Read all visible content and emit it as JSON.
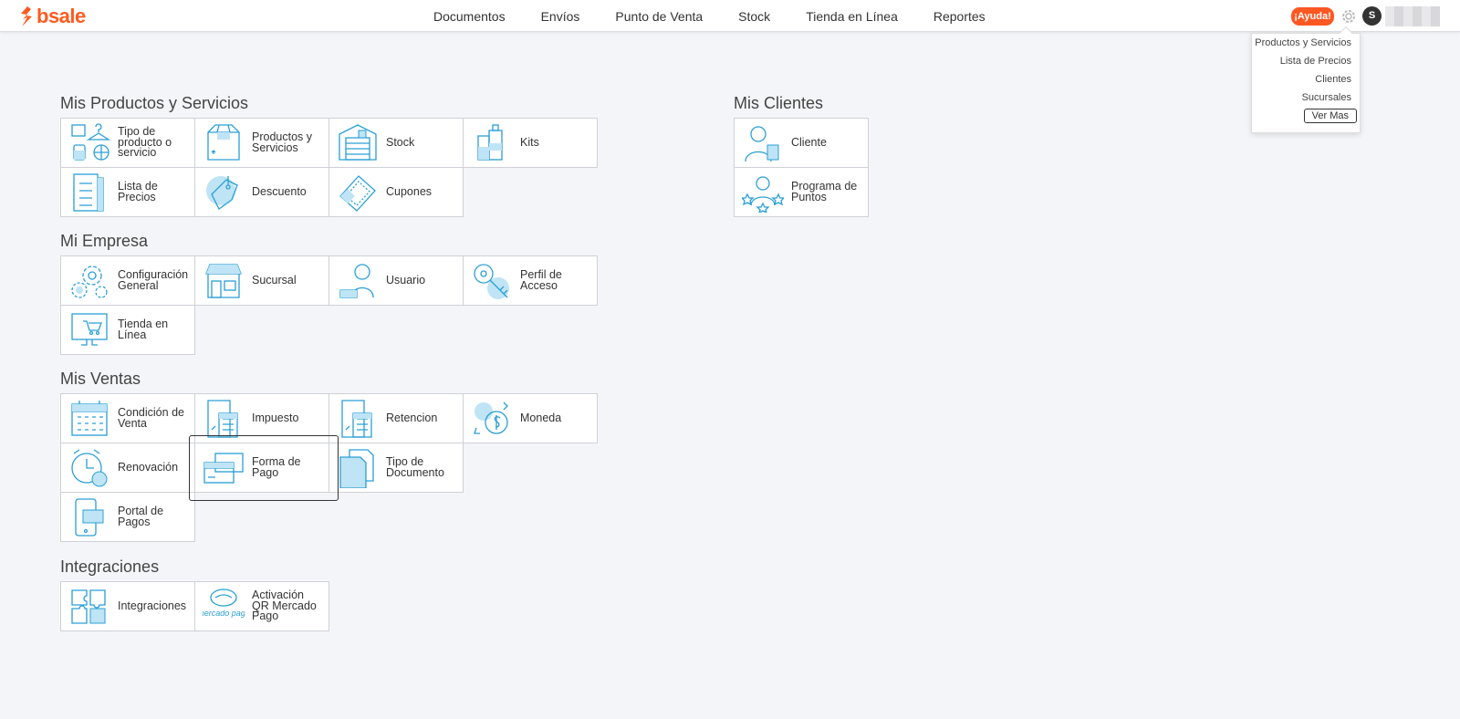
{
  "brand": {
    "name": "bsale",
    "color": "#ff5a1f"
  },
  "nav": [
    "Documentos",
    "Envíos",
    "Punto de Venta",
    "Stock",
    "Tienda en Línea",
    "Reportes"
  ],
  "header": {
    "help_label": "¡Ayuda!",
    "avatar_initial": "S"
  },
  "dropdown": {
    "items": [
      "Productos y Servicios",
      "Lista de Precios",
      "Clientes",
      "Sucursales"
    ],
    "more_label": "Ver Mas"
  },
  "sections": {
    "productos": {
      "title": "Mis Productos y Servicios",
      "tiles": [
        {
          "label": "Tipo de producto o servicio",
          "icon": "product-type-icon"
        },
        {
          "label": "Productos y Servicios",
          "icon": "box-icon"
        },
        {
          "label": "Stock",
          "icon": "warehouse-icon"
        },
        {
          "label": "Kits",
          "icon": "kits-icon"
        },
        {
          "label": "Lista de Precios",
          "icon": "price-list-icon"
        },
        {
          "label": "Descuento",
          "icon": "discount-tag-icon"
        },
        {
          "label": "Cupones",
          "icon": "coupon-icon"
        }
      ]
    },
    "clientes": {
      "title": "Mis Clientes",
      "tiles": [
        {
          "label": "Cliente",
          "icon": "client-icon"
        },
        {
          "label": "Programa de Puntos",
          "icon": "points-program-icon"
        }
      ]
    },
    "empresa": {
      "title": "Mi Empresa",
      "tiles": [
        {
          "label": "Configuración General",
          "icon": "gears-icon"
        },
        {
          "label": "Sucursal",
          "icon": "store-icon"
        },
        {
          "label": "Usuario",
          "icon": "user-laptop-icon"
        },
        {
          "label": "Perfil de Acceso",
          "icon": "key-icon"
        },
        {
          "label": "Tienda en Línea",
          "icon": "online-store-icon"
        }
      ]
    },
    "ventas": {
      "title": "Mis Ventas",
      "tiles": [
        {
          "label": "Condición de Venta",
          "icon": "calendar-icon"
        },
        {
          "label": "Impuesto",
          "icon": "tax-calculator-icon"
        },
        {
          "label": "Retencion",
          "icon": "retention-calculator-icon"
        },
        {
          "label": "Moneda",
          "icon": "currency-exchange-icon"
        },
        {
          "label": "Renovación",
          "icon": "alarm-clock-icon"
        },
        {
          "label": "Forma de Pago",
          "icon": "credit-card-icon"
        },
        {
          "label": "Tipo de Documento",
          "icon": "documents-icon"
        },
        {
          "label": "Portal de Pagos",
          "icon": "mobile-payment-icon"
        }
      ]
    },
    "integraciones": {
      "title": "Integraciones",
      "tiles": [
        {
          "label": "Integraciones",
          "icon": "puzzle-icon"
        },
        {
          "label": "Activación QR Mercado Pago",
          "icon": "mercado-pago-icon",
          "logo_text": "mercado pago"
        }
      ]
    }
  }
}
